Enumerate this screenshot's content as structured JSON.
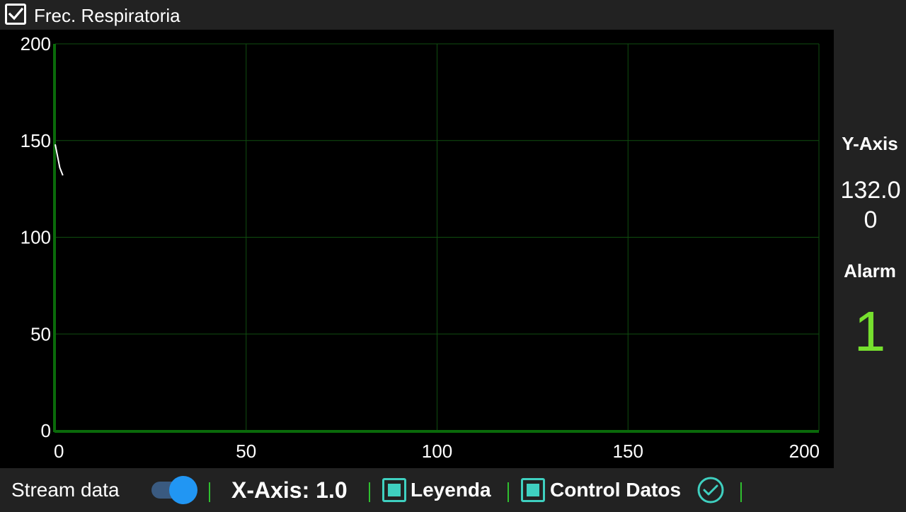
{
  "header": {
    "title": "Frec. Respiratoria",
    "checked": true
  },
  "side_panel": {
    "y_axis_label": "Y-Axis",
    "y_axis_value": "132.00",
    "alarm_label": "Alarm",
    "alarm_value": "1"
  },
  "bottom_bar": {
    "stream_label": "Stream data",
    "stream_on": true,
    "x_axis_label": "X-Axis: 1.0",
    "legend_label": "Leyenda",
    "control_label": "Control Datos"
  },
  "colors": {
    "background": "#000000",
    "grid": "#0f4d0f",
    "axis": "#0a6a0a",
    "trace": "#ffffff",
    "alarm": "#76e02e",
    "toggle": "#2196f3",
    "checkbox_teal": "#3fd0c0",
    "separator": "#2fbf2f"
  },
  "chart_data": {
    "type": "line",
    "title": "",
    "xlabel": "",
    "ylabel": "",
    "xlim": [
      0,
      200
    ],
    "ylim": [
      0,
      200
    ],
    "x_ticks": [
      "0",
      "50",
      "100",
      "150",
      "200"
    ],
    "y_ticks": [
      "0",
      "50",
      "100",
      "150",
      "200"
    ],
    "grid": true,
    "series": [
      {
        "x": [
          0,
          0.1,
          0.2,
          0.4,
          0.6,
          0.8,
          1.0,
          1.2,
          1.6,
          1.8,
          2.0
        ],
        "y": [
          148,
          147,
          146,
          144,
          142,
          140,
          138,
          136,
          134,
          133,
          132
        ]
      }
    ]
  }
}
